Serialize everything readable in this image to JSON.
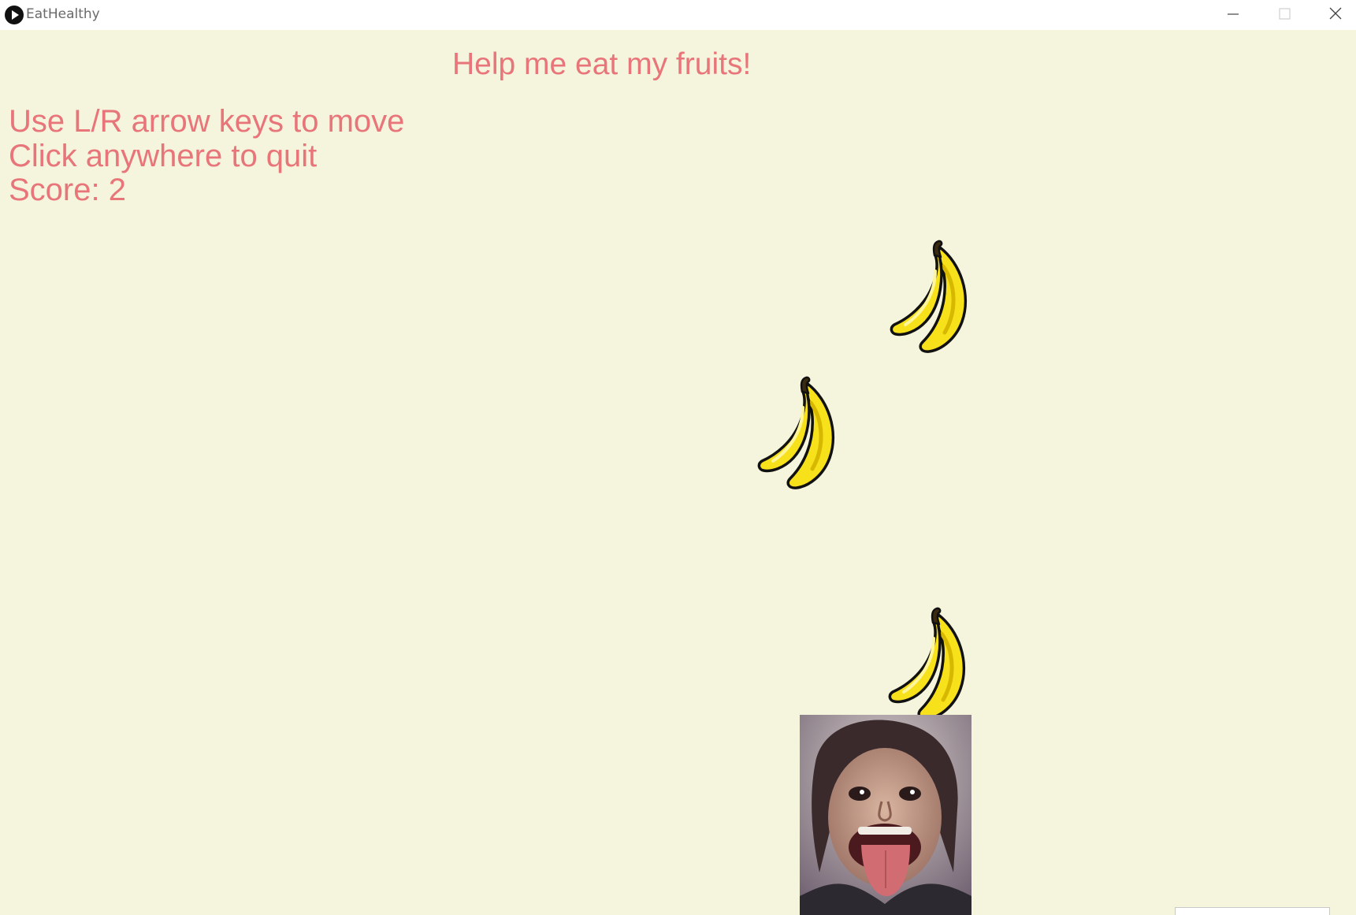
{
  "window": {
    "title": "EatHealthy",
    "app_icon": "play-icon",
    "controls": [
      "minimize-icon",
      "maximize-icon",
      "close-icon"
    ]
  },
  "game": {
    "heading": "Help me eat my fruits!",
    "instructions": [
      "Use L/R arrow keys to move",
      "Click anywhere to quit"
    ],
    "score_label": "Score:",
    "score": 2,
    "score_text": "Score: 2",
    "falling_fruit": [
      "banana",
      "banana",
      "banana"
    ],
    "player": "face-with-open-mouth"
  },
  "colors": {
    "background": "#f5f4dc",
    "text": "#e8757a",
    "banana_fill": "#f7e11b",
    "banana_outline": "#111111"
  }
}
